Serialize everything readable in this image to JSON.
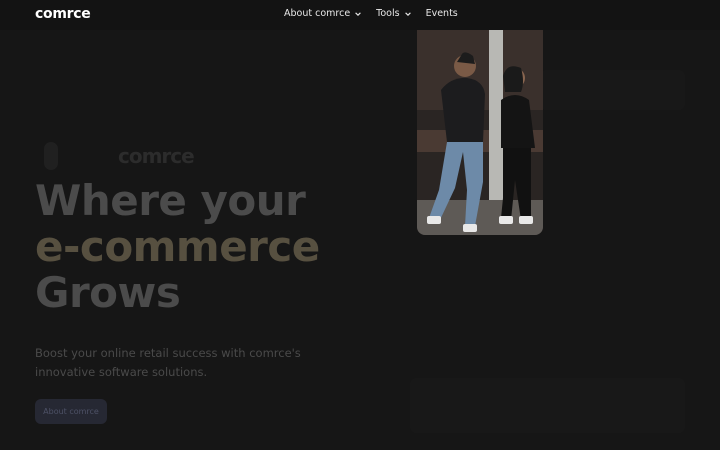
{
  "brand": {
    "logo_text": "comrce",
    "ghost_logo_text": "comrce"
  },
  "nav": {
    "items": [
      {
        "label": "About comrce",
        "has_dropdown": true
      },
      {
        "label": "Tools",
        "has_dropdown": true
      },
      {
        "label": "Events",
        "has_dropdown": false
      }
    ]
  },
  "hero": {
    "headline_line_1": "Where your",
    "headline_line_2": "e-commerce",
    "headline_line_3": "Grows",
    "subtext": "Boost your online retail success with comrce's innovative software solutions.",
    "cta_label": "About comrce",
    "image_alt": "photo-two-people-talking"
  },
  "colors": {
    "background": "#161616",
    "accent_muted": "#575040",
    "button_bg": "#262833"
  }
}
